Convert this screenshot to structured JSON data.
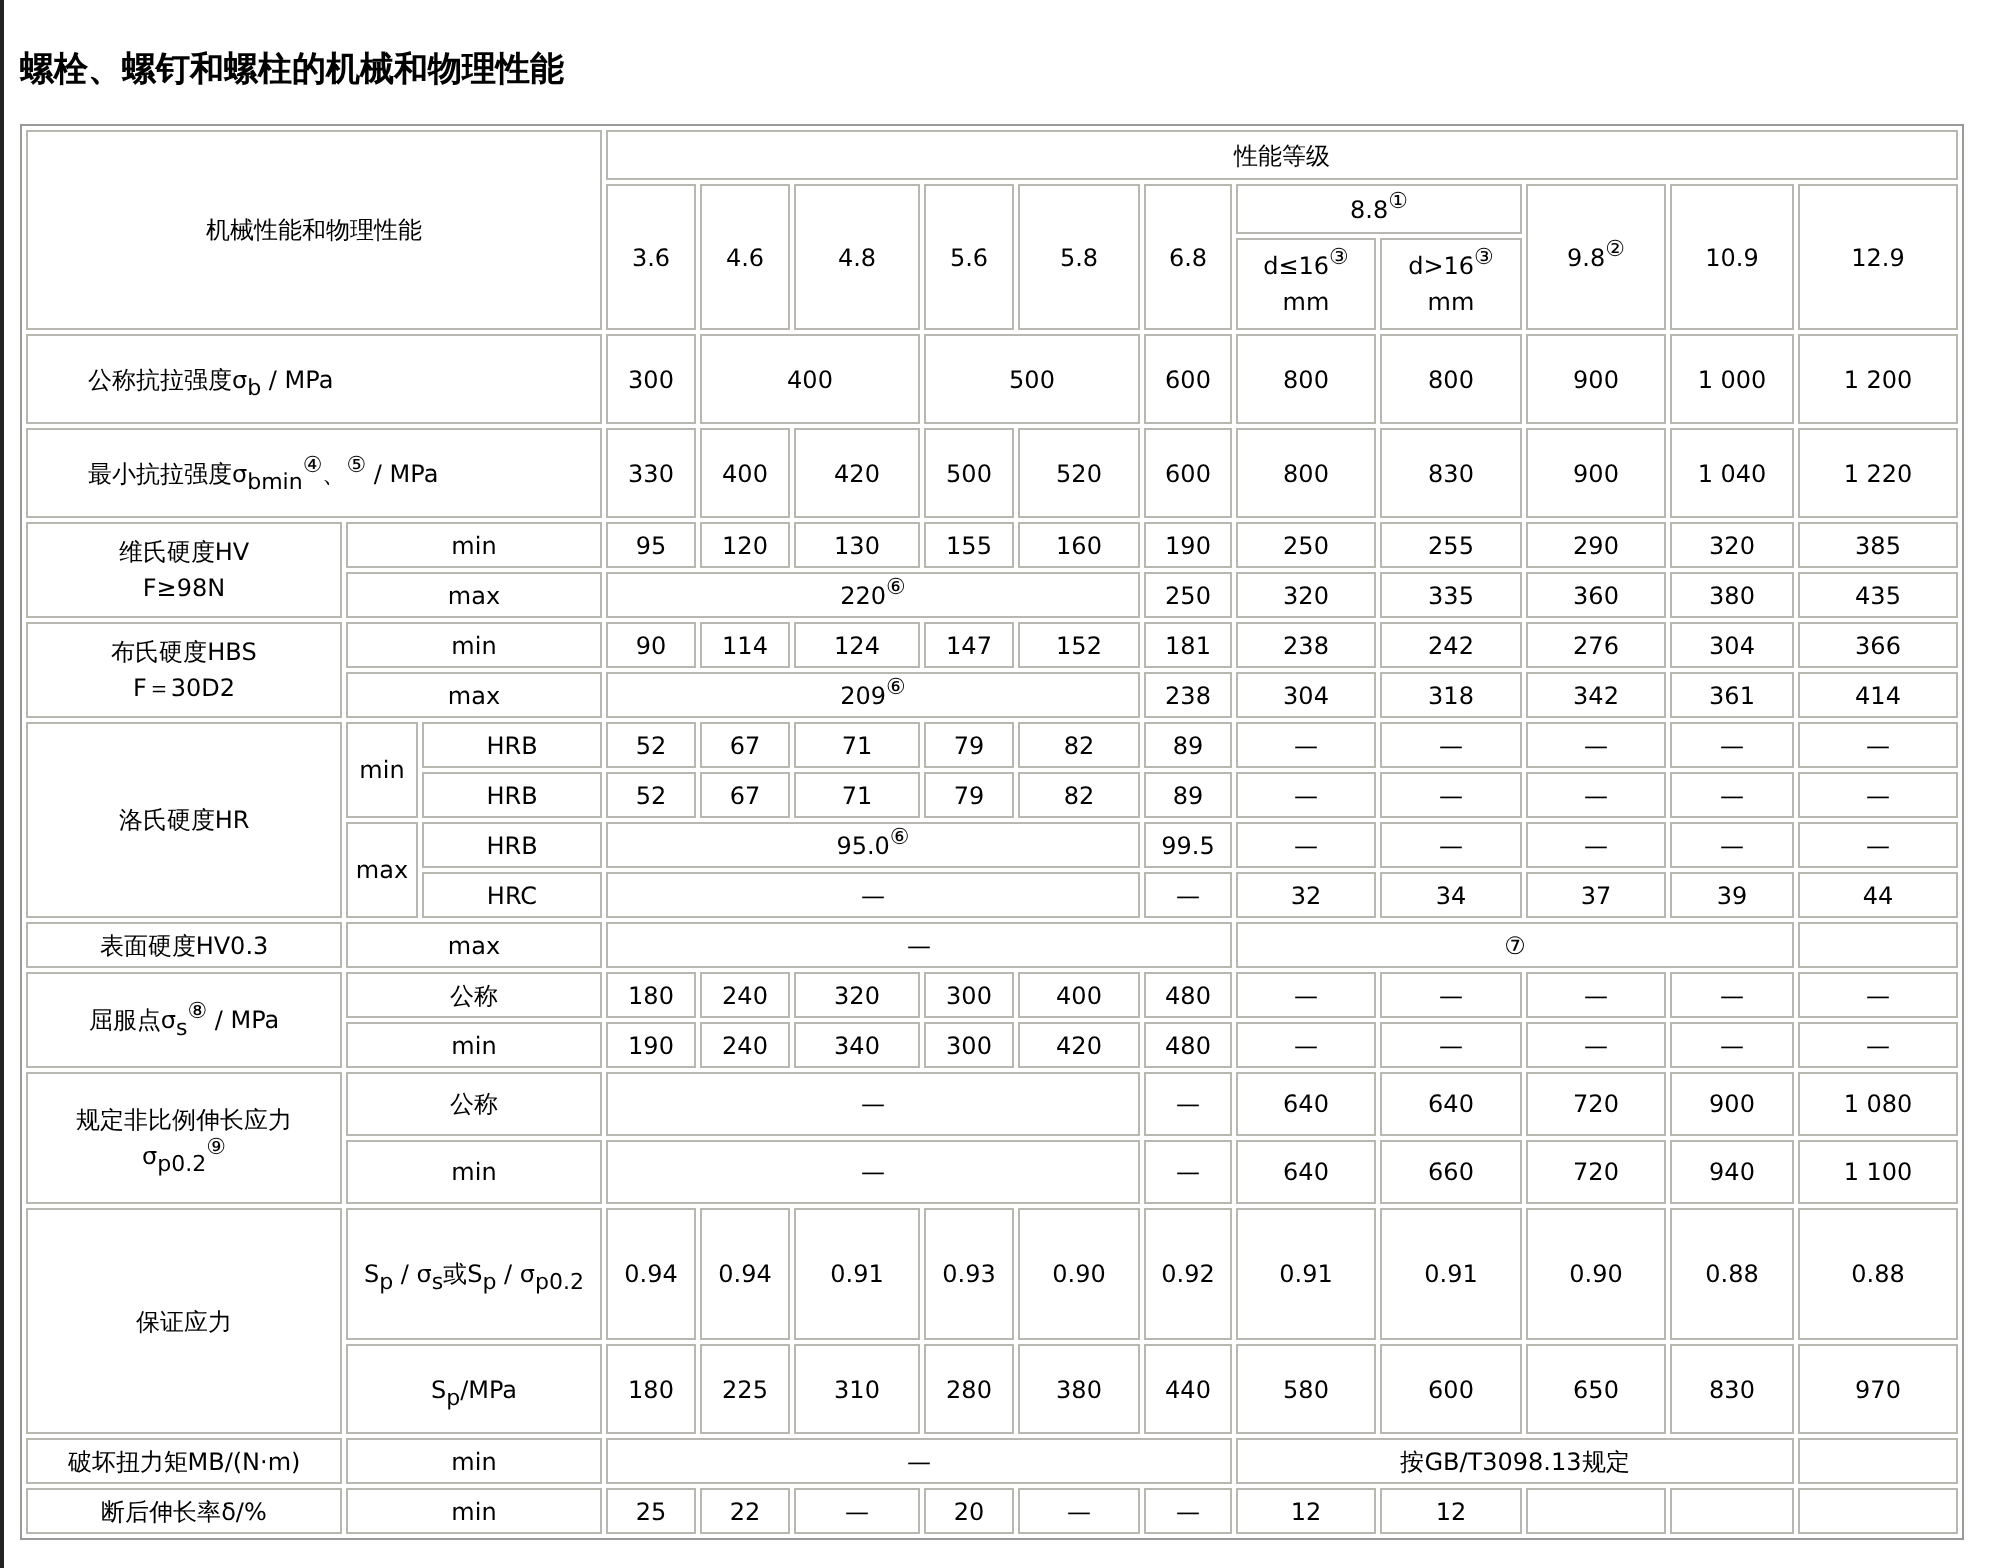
{
  "title": "螺栓、螺钉和螺柱的机械和物理性能",
  "table": {
    "rows": [
      {
        "cells": [
          {
            "text": "机械性能和物理性能",
            "colspan": 3,
            "rowspan": 3
          },
          {
            "text": "性能等级",
            "colspan": 11
          }
        ]
      },
      {
        "cells": [
          {
            "text": "3.6",
            "rowspan": 2
          },
          {
            "text": "4.6",
            "rowspan": 2
          },
          {
            "text": "4.8",
            "rowspan": 2
          },
          {
            "text": "5.6",
            "rowspan": 2
          },
          {
            "text": "5.8",
            "rowspan": 2
          },
          {
            "text": "6.8",
            "rowspan": 2
          },
          {
            "text": "8.8$^{①}$",
            "colspan": 2
          },
          {
            "text": "9.8$^{②}$",
            "rowspan": 2
          },
          {
            "text": "10.9",
            "rowspan": 2
          },
          {
            "text": "12.9",
            "rowspan": 2
          }
        ]
      },
      {
        "cells": [
          {
            "lines": [
              "d≤16$^{③}$",
              "mm"
            ]
          },
          {
            "lines": [
              "d>16$^{③}$",
              "mm"
            ]
          }
        ]
      },
      {
        "cells": [
          {
            "text": "公称抗拉强度σ$_{b}$ / MPa",
            "colspan": 3
          },
          {
            "text": "300"
          },
          {
            "text": "400",
            "colspan": 2
          },
          {
            "text": "500",
            "colspan": 2
          },
          {
            "text": "600"
          },
          {
            "text": "800"
          },
          {
            "text": "800"
          },
          {
            "text": "900"
          },
          {
            "text": "1 000"
          },
          {
            "text": "1 200"
          }
        ]
      },
      {
        "cells": [
          {
            "text": "最小抗拉强度σ$_{bmin}$$^{④}$、$^{⑤}$ / MPa",
            "colspan": 3
          },
          {
            "text": "330"
          },
          {
            "text": "400"
          },
          {
            "text": "420"
          },
          {
            "text": "500"
          },
          {
            "text": "520"
          },
          {
            "text": "600"
          },
          {
            "text": "800"
          },
          {
            "text": "830"
          },
          {
            "text": "900"
          },
          {
            "text": "1 040"
          },
          {
            "text": "1 220"
          }
        ]
      },
      {
        "cells": [
          {
            "lines": [
              "维氏硬度HV",
              "F≥98N"
            ],
            "rowspan": 2
          },
          {
            "text": "min",
            "colspan": 2
          },
          {
            "text": "95"
          },
          {
            "text": "120"
          },
          {
            "text": "130"
          },
          {
            "text": "155"
          },
          {
            "text": "160"
          },
          {
            "text": "190"
          },
          {
            "text": "250"
          },
          {
            "text": "255"
          },
          {
            "text": "290"
          },
          {
            "text": "320"
          },
          {
            "text": "385"
          }
        ]
      },
      {
        "cells": [
          {
            "text": "max",
            "colspan": 2
          },
          {
            "text": "220$^{⑥}$",
            "colspan": 5
          },
          {
            "text": "250"
          },
          {
            "text": "320"
          },
          {
            "text": "335"
          },
          {
            "text": "360"
          },
          {
            "text": "380"
          },
          {
            "text": "435"
          }
        ]
      },
      {
        "cells": [
          {
            "lines": [
              "布氏硬度HBS",
              "F＝30D2"
            ],
            "rowspan": 2
          },
          {
            "text": "min",
            "colspan": 2
          },
          {
            "text": "90"
          },
          {
            "text": "114"
          },
          {
            "text": "124"
          },
          {
            "text": "147"
          },
          {
            "text": "152"
          },
          {
            "text": "181"
          },
          {
            "text": "238"
          },
          {
            "text": "242"
          },
          {
            "text": "276"
          },
          {
            "text": "304"
          },
          {
            "text": "366"
          }
        ]
      },
      {
        "cells": [
          {
            "text": "max",
            "colspan": 2
          },
          {
            "text": "209$^{⑥}$",
            "colspan": 5
          },
          {
            "text": "238"
          },
          {
            "text": "304"
          },
          {
            "text": "318"
          },
          {
            "text": "342"
          },
          {
            "text": "361"
          },
          {
            "text": "414"
          }
        ]
      },
      {
        "cells": [
          {
            "text": "洛氏硬度HR",
            "rowspan": 4
          },
          {
            "text": "min",
            "rowspan": 2
          },
          {
            "text": "HRB"
          },
          {
            "text": "52"
          },
          {
            "text": "67"
          },
          {
            "text": "71"
          },
          {
            "text": "79"
          },
          {
            "text": "82"
          },
          {
            "text": "89"
          },
          {
            "text": "—"
          },
          {
            "text": "—"
          },
          {
            "text": "—"
          },
          {
            "text": "—"
          },
          {
            "text": "—"
          }
        ]
      },
      {
        "cells": [
          {
            "text": "HRB"
          },
          {
            "text": "52"
          },
          {
            "text": "67"
          },
          {
            "text": "71"
          },
          {
            "text": "79"
          },
          {
            "text": "82"
          },
          {
            "text": "89"
          },
          {
            "text": "—"
          },
          {
            "text": "—"
          },
          {
            "text": "—"
          },
          {
            "text": "—"
          },
          {
            "text": "—"
          }
        ]
      },
      {
        "cells": [
          {
            "text": "max",
            "rowspan": 2
          },
          {
            "text": "HRB"
          },
          {
            "text": "95.0$^{⑥}$",
            "colspan": 5
          },
          {
            "text": "99.5"
          },
          {
            "text": "—"
          },
          {
            "text": "—"
          },
          {
            "text": "—"
          },
          {
            "text": "—"
          },
          {
            "text": "—"
          }
        ]
      },
      {
        "cells": [
          {
            "text": "HRC"
          },
          {
            "text": "—",
            "colspan": 5
          },
          {
            "text": "—"
          },
          {
            "text": "32"
          },
          {
            "text": "34"
          },
          {
            "text": "37"
          },
          {
            "text": "39"
          },
          {
            "text": "44"
          }
        ]
      },
      {
        "cells": [
          {
            "text": "表面硬度HV0.3"
          },
          {
            "text": "max",
            "colspan": 2
          },
          {
            "text": "—",
            "colspan": 6
          },
          {
            "text": "⑦",
            "colspan": 4
          },
          {}
        ]
      },
      {
        "cells": [
          {
            "text": "屈服点σ$_{s}$$^{⑧}$ / MPa",
            "rowspan": 2
          },
          {
            "text": "公称",
            "colspan": 2
          },
          {
            "text": "180"
          },
          {
            "text": "240"
          },
          {
            "text": "320"
          },
          {
            "text": "300"
          },
          {
            "text": "400"
          },
          {
            "text": "480"
          },
          {
            "text": "—"
          },
          {
            "text": "—"
          },
          {
            "text": "—"
          },
          {
            "text": "—"
          },
          {
            "text": "—"
          }
        ]
      },
      {
        "cells": [
          {
            "text": "min",
            "colspan": 2
          },
          {
            "text": "190"
          },
          {
            "text": "240"
          },
          {
            "text": "340"
          },
          {
            "text": "300"
          },
          {
            "text": "420"
          },
          {
            "text": "480"
          },
          {
            "text": "—"
          },
          {
            "text": "—"
          },
          {
            "text": "—"
          },
          {
            "text": "—"
          },
          {
            "text": "—"
          }
        ]
      },
      {
        "cells": [
          {
            "lines": [
              "规定非比例伸长应力",
              "σ$_{p0.2}$$^{⑨}$"
            ],
            "rowspan": 2
          },
          {
            "text": "公称",
            "colspan": 2
          },
          {
            "text": "—",
            "colspan": 5
          },
          {
            "text": "—"
          },
          {
            "text": "640"
          },
          {
            "text": "640"
          },
          {
            "text": "720"
          },
          {
            "text": "900"
          },
          {
            "text": "1 080"
          }
        ]
      },
      {
        "cells": [
          {
            "text": "min",
            "colspan": 2
          },
          {
            "text": "—",
            "colspan": 5
          },
          {
            "text": "—"
          },
          {
            "text": "640"
          },
          {
            "text": "660"
          },
          {
            "text": "720"
          },
          {
            "text": "940"
          },
          {
            "text": "1 100"
          }
        ]
      },
      {
        "cells": [
          {
            "text": "保证应力",
            "rowspan": 2
          },
          {
            "text": "S$_{p}$ / σ$_{s}$或S$_{p}$ / σ$_{p0.2}$",
            "colspan": 2
          },
          {
            "text": "0.94"
          },
          {
            "text": "0.94"
          },
          {
            "text": "0.91"
          },
          {
            "text": "0.93"
          },
          {
            "text": "0.90"
          },
          {
            "text": "0.92"
          },
          {
            "text": "0.91"
          },
          {
            "text": "0.91"
          },
          {
            "text": "0.90"
          },
          {
            "text": "0.88"
          },
          {
            "text": "0.88"
          }
        ]
      },
      {
        "cells": [
          {
            "text": "S$_{p}$/MPa",
            "colspan": 2
          },
          {
            "text": "180"
          },
          {
            "text": "225"
          },
          {
            "text": "310"
          },
          {
            "text": "280"
          },
          {
            "text": "380"
          },
          {
            "text": "440"
          },
          {
            "text": "580"
          },
          {
            "text": "600"
          },
          {
            "text": "650"
          },
          {
            "text": "830"
          },
          {
            "text": "970"
          }
        ]
      },
      {
        "cells": [
          {
            "text": "破坏扭力矩MB/(N·m)"
          },
          {
            "text": "min",
            "colspan": 2
          },
          {
            "text": "—",
            "colspan": 6
          },
          {
            "text": "按GB/T3098.13规定",
            "colspan": 4
          },
          {}
        ]
      },
      {
        "cells": [
          {
            "text": "断后伸长率δ/%"
          },
          {
            "text": "min",
            "colspan": 2
          },
          {
            "text": "25"
          },
          {
            "text": "22"
          },
          {
            "text": "—"
          },
          {
            "text": "20"
          },
          {
            "text": "—"
          },
          {
            "text": "—"
          },
          {
            "text": "12"
          },
          {
            "text": "12"
          },
          {},
          {},
          {}
        ]
      }
    ]
  }
}
